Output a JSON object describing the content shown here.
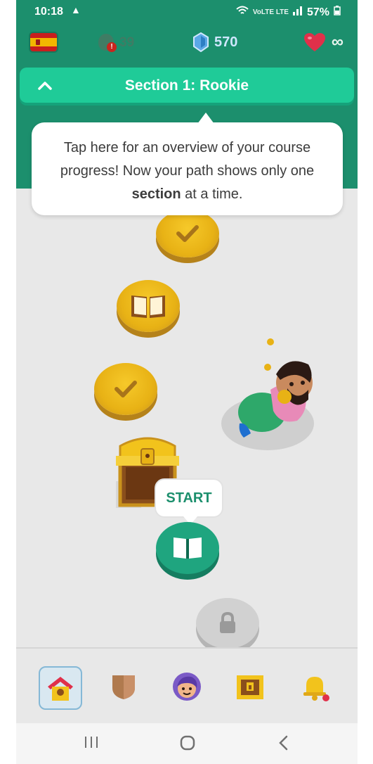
{
  "status_bar": {
    "time": "10:18",
    "warning_icon": "warning-triangle-icon",
    "network": "VoLTE LTE",
    "battery": "57%"
  },
  "top_bar": {
    "language_flag": "spain-flag-icon",
    "streak_count": "39",
    "gems_count": "570",
    "hearts": "∞"
  },
  "section_banner": {
    "title": "Section 1: Rookie",
    "toggle_icon": "chevron-up-icon"
  },
  "tooltip": {
    "line_prefix": "Tap here for an overview of your course progress! Now your path shows only one ",
    "bold_word": "section",
    "line_suffix": " at a time."
  },
  "path": {
    "start_label": "START"
  },
  "bottom_nav": {
    "items": [
      "home-icon",
      "leagues-shield-icon",
      "profile-avatar-icon",
      "treasure-chest-icon",
      "notifications-bell-icon"
    ]
  },
  "colors": {
    "brand_green": "#1c8f6d",
    "banner_green": "#1fcb98",
    "gold": "#e8b215",
    "start_green": "#1fa57f"
  }
}
